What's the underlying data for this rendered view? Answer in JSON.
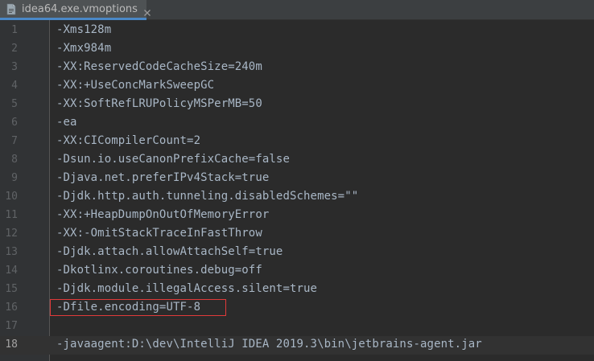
{
  "tab": {
    "label": "idea64.exe.vmoptions",
    "file_icon": "file-icon",
    "close_icon": "close-icon",
    "accent": "#4a88c7"
  },
  "editor": {
    "lines": [
      {
        "number": "1",
        "text": "-Xms128m"
      },
      {
        "number": "2",
        "text": "-Xmx984m"
      },
      {
        "number": "3",
        "text": "-XX:ReservedCodeCacheSize=240m"
      },
      {
        "number": "4",
        "text": "-XX:+UseConcMarkSweepGC"
      },
      {
        "number": "5",
        "text": "-XX:SoftRefLRUPolicyMSPerMB=50"
      },
      {
        "number": "6",
        "text": "-ea"
      },
      {
        "number": "7",
        "text": "-XX:CICompilerCount=2"
      },
      {
        "number": "8",
        "text": "-Dsun.io.useCanonPrefixCache=false"
      },
      {
        "number": "9",
        "text": "-Djava.net.preferIPv4Stack=true"
      },
      {
        "number": "10",
        "text": "-Djdk.http.auth.tunneling.disabledSchemes=\"\""
      },
      {
        "number": "11",
        "text": "-XX:+HeapDumpOnOutOfMemoryError"
      },
      {
        "number": "12",
        "text": "-XX:-OmitStackTraceInFastThrow"
      },
      {
        "number": "13",
        "text": "-Djdk.attach.allowAttachSelf=true"
      },
      {
        "number": "14",
        "text": "-Dkotlinx.coroutines.debug=off"
      },
      {
        "number": "15",
        "text": "-Djdk.module.illegalAccess.silent=true"
      },
      {
        "number": "16",
        "text": "-Dfile.encoding=UTF-8"
      },
      {
        "number": "17",
        "text": ""
      },
      {
        "number": "18",
        "text": "-javaagent:D:\\dev\\IntelliJ IDEA 2019.3\\bin\\jetbrains-agent.jar"
      }
    ],
    "current_line": "18",
    "highlighted_line": "16",
    "highlight_color": "#e03a3a"
  }
}
